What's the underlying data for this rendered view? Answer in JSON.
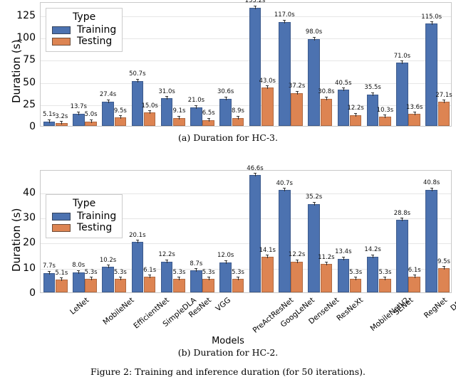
{
  "figure": {
    "caption": "Figure 2: Training and inference duration (for 50 iterations).",
    "subcaption_a": "(a) Duration for HC-3.",
    "subcaption_b": "(b) Duration for HC-2."
  },
  "legend": {
    "title": "Type",
    "items": [
      {
        "label": "Training",
        "color": "#4c72b0"
      },
      {
        "label": "Testing",
        "color": "#dd8452"
      }
    ]
  },
  "chart_data": [
    {
      "type": "bar",
      "title": "(a) Duration for HC-3.",
      "xlabel": "",
      "ylabel": "Duration (s)",
      "ylim": [
        0,
        140
      ],
      "yticks": [
        0,
        25,
        50,
        75,
        100,
        125
      ],
      "ytick_labels": [
        "0",
        "25",
        "50",
        "75",
        "100",
        "125"
      ],
      "grid": true,
      "legend_position": "upper left",
      "categories": [
        "LeNet",
        "MobileNet",
        "EfficientNet",
        "SimpleDLA",
        "ResNet",
        "VGG",
        "PreActResNet",
        "GoogLeNet",
        "DenseNet",
        "ResNeXt",
        "MobileNetV2",
        "SENet",
        "RegNet",
        "DPN"
      ],
      "series": [
        {
          "name": "Training",
          "color": "#4c72b0",
          "values": [
            5.1,
            13.7,
            27.4,
            50.7,
            31.0,
            21.0,
            30.6,
            133.2,
            117.0,
            98.0,
            40.5,
            35.5,
            71.0,
            115.0
          ],
          "labels": [
            "5.1s",
            "13.7s",
            "27.4s",
            "50.7s",
            "31.0s",
            "21.0s",
            "30.6s",
            "133.2s",
            "117.0s",
            "98.0s",
            "40.5s",
            "35.5s",
            "71.0s",
            "115.0s"
          ]
        },
        {
          "name": "Testing",
          "color": "#dd8452",
          "values": [
            3.2,
            5.0,
            9.5,
            15.0,
            9.1,
            6.5,
            8.9,
            43.0,
            37.2,
            30.8,
            12.2,
            10.3,
            13.6,
            27.1
          ],
          "labels": [
            "3.2s",
            "5.0s",
            "9.5s",
            "15.0s",
            "9.1s",
            "6.5s",
            "8.9s",
            "43.0s",
            "37.2s",
            "30.8s",
            "12.2s",
            "10.3s",
            "13.6s",
            "27.1s"
          ]
        }
      ]
    },
    {
      "type": "bar",
      "title": "(b) Duration for HC-2.",
      "xlabel": "Models",
      "ylabel": "Duration (s)",
      "ylim": [
        0,
        49
      ],
      "yticks": [
        0,
        10,
        20,
        30,
        40
      ],
      "ytick_labels": [
        "0",
        "10",
        "20",
        "30",
        "40"
      ],
      "grid": true,
      "legend_position": "upper left",
      "categories": [
        "LeNet",
        "MobileNet",
        "EfficientNet",
        "SimpleDLA",
        "ResNet",
        "VGG",
        "PreActResNet",
        "GoogLeNet",
        "DenseNet",
        "ResNeXt",
        "MobileNetV2",
        "SENet",
        "RegNet",
        "DPN"
      ],
      "series": [
        {
          "name": "Training",
          "color": "#4c72b0",
          "values": [
            7.7,
            8.0,
            10.2,
            20.1,
            12.2,
            8.7,
            12.0,
            46.6,
            40.7,
            35.2,
            13.4,
            14.2,
            28.8,
            40.8
          ],
          "labels": [
            "7.7s",
            "8.0s",
            "10.2s",
            "20.1s",
            "12.2s",
            "8.7s",
            "12.0s",
            "46.6s",
            "40.7s",
            "35.2s",
            "13.4s",
            "14.2s",
            "28.8s",
            "40.8s"
          ]
        },
        {
          "name": "Testing",
          "color": "#dd8452",
          "values": [
            5.1,
            5.3,
            5.3,
            6.1,
            5.3,
            5.3,
            5.3,
            14.1,
            12.2,
            11.2,
            5.3,
            5.3,
            6.1,
            9.5
          ],
          "labels": [
            "5.1s",
            "5.3s",
            "5.3s",
            "6.1s",
            "5.3s",
            "5.3s",
            "5.3s",
            "14.1s",
            "12.2s",
            "11.2s",
            "5.3s",
            "5.3s",
            "6.1s",
            "9.5s"
          ]
        }
      ]
    }
  ]
}
